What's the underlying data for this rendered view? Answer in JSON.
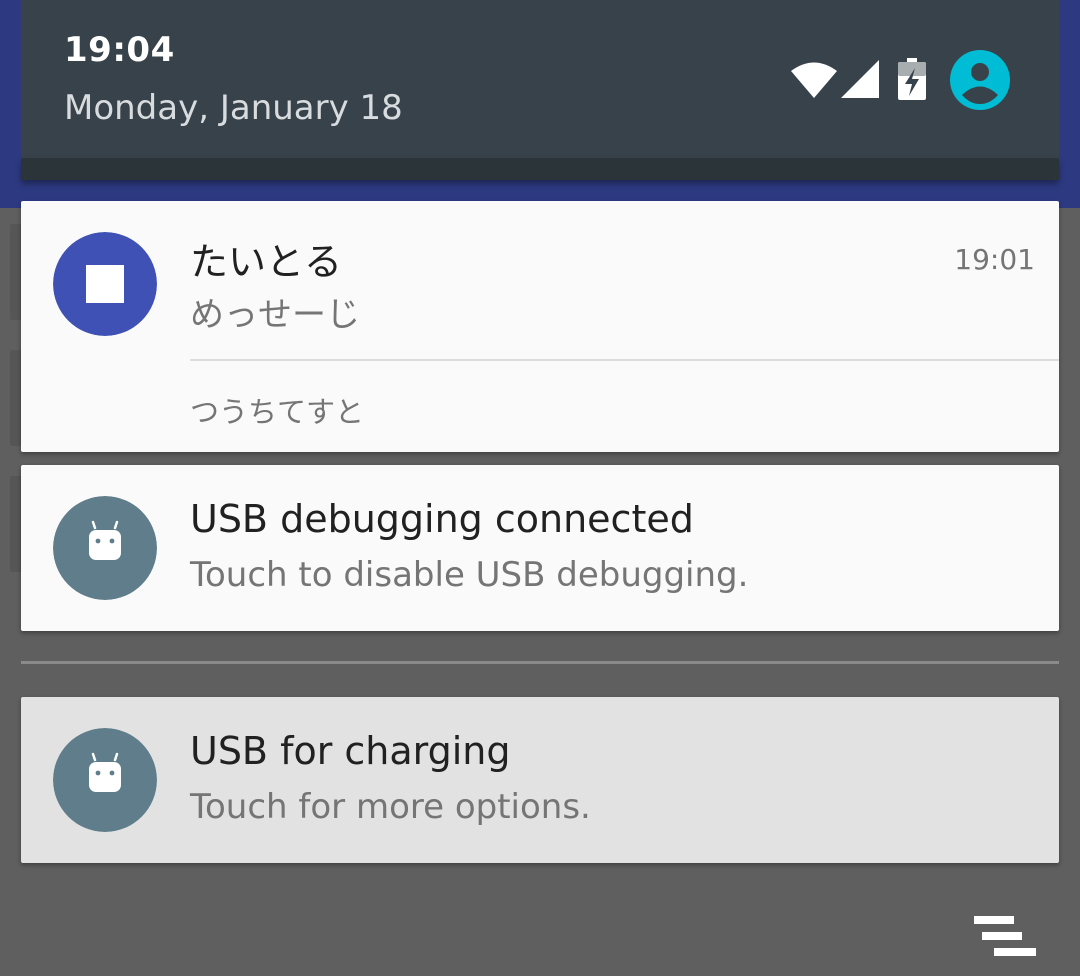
{
  "header": {
    "time": "19:04",
    "date": "Monday, January 18"
  },
  "status_icons": [
    "wifi-icon",
    "signal-icon",
    "battery-charging-icon",
    "account-icon"
  ],
  "notifications": [
    {
      "title": "たいとる",
      "text": "めっせーじ",
      "time": "19:01",
      "subtext": "つうちてすと",
      "icon": "stop-square-icon",
      "icon_color": "#3f51b5"
    },
    {
      "title": "USB debugging connected",
      "text": "Touch to disable USB debugging.",
      "icon": "android-icon",
      "icon_color": "#607d8b"
    },
    {
      "title": "USB for charging",
      "text": "Touch for more options.",
      "icon": "android-icon",
      "icon_color": "#607d8b"
    }
  ],
  "footer": {
    "clear_all_icon": "clear-all-icon"
  },
  "colors": {
    "header_bg": "#37424a",
    "accent_teal": "#00bcd4",
    "scrim": "#5f5f5f",
    "app_bar": "#2d3a82"
  }
}
